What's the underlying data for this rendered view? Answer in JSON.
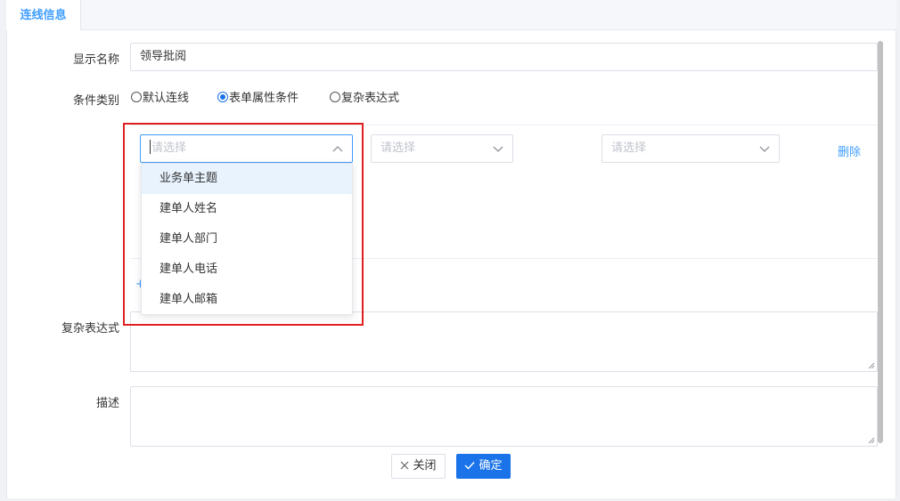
{
  "tabs": [
    {
      "label": "连线信息",
      "active": true
    }
  ],
  "form": {
    "display_name_label": "显示名称",
    "display_name_value": "领导批阅",
    "condition_type_label": "条件类别",
    "condition_types": [
      {
        "label": "默认连线",
        "checked": false
      },
      {
        "label": "表单属性条件",
        "checked": true
      },
      {
        "label": "复杂表达式",
        "checked": false
      }
    ],
    "condition_row": {
      "field_placeholder": "请选择",
      "operator_placeholder": "请选择",
      "value_placeholder": "请选择",
      "delete_label": "删除"
    },
    "add_label": "+",
    "complex_expression_label": "复杂表达式",
    "complex_expression_value": "",
    "description_label": "描述",
    "description_value": ""
  },
  "dropdown": {
    "open": true,
    "options": [
      "业务单主题",
      "建单人姓名",
      "建单人部门",
      "建单人电话",
      "建单人邮箱"
    ],
    "hovered_index": 0
  },
  "footer": {
    "close_label": "关闭",
    "confirm_label": "确定"
  },
  "colors": {
    "accent": "#409eff",
    "primary_button": "#1a73e8",
    "highlight_box": "#e02020",
    "hover_option": "#e8f3fe"
  },
  "icons": [
    "chevron-up-icon",
    "chevron-down-icon",
    "close-icon",
    "check-icon",
    "resize-grip-icon"
  ]
}
